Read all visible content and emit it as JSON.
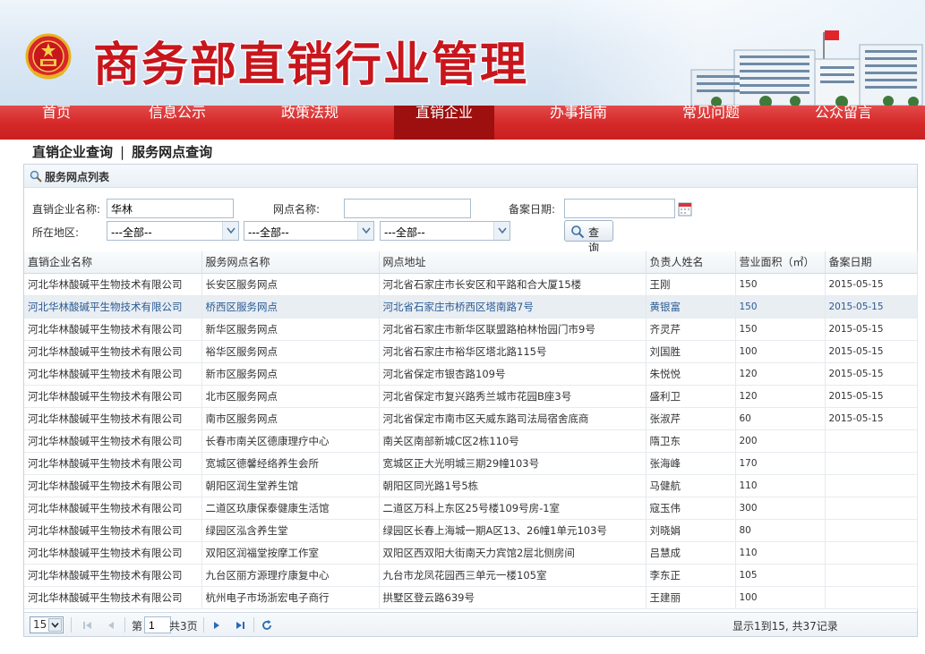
{
  "site": {
    "title": "商务部直销行业管理"
  },
  "nav": {
    "items": [
      {
        "label": "首页"
      },
      {
        "label": "信息公示"
      },
      {
        "label": "政策法规"
      },
      {
        "label": "直销企业",
        "active": true
      },
      {
        "label": "办事指南"
      },
      {
        "label": "常见问题"
      },
      {
        "label": "公众留言"
      }
    ]
  },
  "breadcrumb": {
    "item1": "直销企业查询",
    "separator": "|",
    "item2": "服务网点查询"
  },
  "panel": {
    "title": "服务网点列表"
  },
  "search": {
    "company_label": "直销企业名称:",
    "company_value": "华林",
    "outlet_label": "网点名称:",
    "outlet_value": "",
    "date_label": "备案日期:",
    "date_value": "",
    "region_label": "所在地区:",
    "region1": "---全部--",
    "region2": "---全部--",
    "region3": "---全部--",
    "button_label": "查询"
  },
  "table": {
    "columns": [
      "直销企业名称",
      "服务网点名称",
      "网点地址",
      "负责人姓名",
      "营业面积（㎡）",
      "备案日期"
    ],
    "rows": [
      [
        "河北华林酸碱平生物技术有限公司",
        "长安区服务网点",
        "河北省石家庄市长安区和平路和合大厦15楼",
        "王刚",
        "150",
        "2015-05-15"
      ],
      [
        "河北华林酸碱平生物技术有限公司",
        "桥西区服务网点",
        "河北省石家庄市桥西区塔南路7号",
        "黄银富",
        "150",
        "2015-05-15"
      ],
      [
        "河北华林酸碱平生物技术有限公司",
        "新华区服务网点",
        "河北省石家庄市新华区联盟路柏林怡园门市9号",
        "齐灵芹",
        "150",
        "2015-05-15"
      ],
      [
        "河北华林酸碱平生物技术有限公司",
        "裕华区服务网点",
        "河北省石家庄市裕华区塔北路115号",
        "刘国胜",
        "100",
        "2015-05-15"
      ],
      [
        "河北华林酸碱平生物技术有限公司",
        "新市区服务网点",
        "河北省保定市银杏路109号",
        "朱悦悦",
        "120",
        "2015-05-15"
      ],
      [
        "河北华林酸碱平生物技术有限公司",
        "北市区服务网点",
        "河北省保定市复兴路秀兰城市花园B座3号",
        "盛利卫",
        "120",
        "2015-05-15"
      ],
      [
        "河北华林酸碱平生物技术有限公司",
        "南市区服务网点",
        "河北省保定市南市区天威东路司法局宿舍底商",
        "张淑芹",
        "60",
        "2015-05-15"
      ],
      [
        "河北华林酸碱平生物技术有限公司",
        "长春市南关区德康理疗中心",
        "南关区南部新城C区2栋110号",
        "隋卫东",
        "200",
        ""
      ],
      [
        "河北华林酸碱平生物技术有限公司",
        "宽城区德馨经络养生会所",
        "宽城区正大光明城三期29幢103号",
        "张海峰",
        "170",
        ""
      ],
      [
        "河北华林酸碱平生物技术有限公司",
        "朝阳区润生堂养生馆",
        "朝阳区同光路1号5栋",
        "马健航",
        "110",
        ""
      ],
      [
        "河北华林酸碱平生物技术有限公司",
        "二道区玖康保泰健康生活馆",
        "二道区万科上东区25号楼109号房-1室",
        "寇玉伟",
        "300",
        ""
      ],
      [
        "河北华林酸碱平生物技术有限公司",
        "绿园区泓含养生堂",
        "绿园区长春上海城一期A区13、26幢1单元103号",
        "刘晓娟",
        "80",
        ""
      ],
      [
        "河北华林酸碱平生物技术有限公司",
        "双阳区润福堂按摩工作室",
        "双阳区西双阳大街南天力宾馆2层北侧房间",
        "吕慧成",
        "110",
        ""
      ],
      [
        "河北华林酸碱平生物技术有限公司",
        "九台区丽方源理疗康复中心",
        "九台市龙凤花园西三单元一楼105室",
        "李东正",
        "105",
        ""
      ],
      [
        "河北华林酸碱平生物技术有限公司",
        "杭州电子市场浙宏电子商行",
        "拱墅区登云路639号",
        "王建丽",
        "100",
        ""
      ]
    ],
    "selected_row": 1
  },
  "pager": {
    "page_size": "15",
    "page_prefix": "第",
    "page_value": "1",
    "page_suffix": "共3页",
    "summary": "显示1到15, 共37记录"
  }
}
